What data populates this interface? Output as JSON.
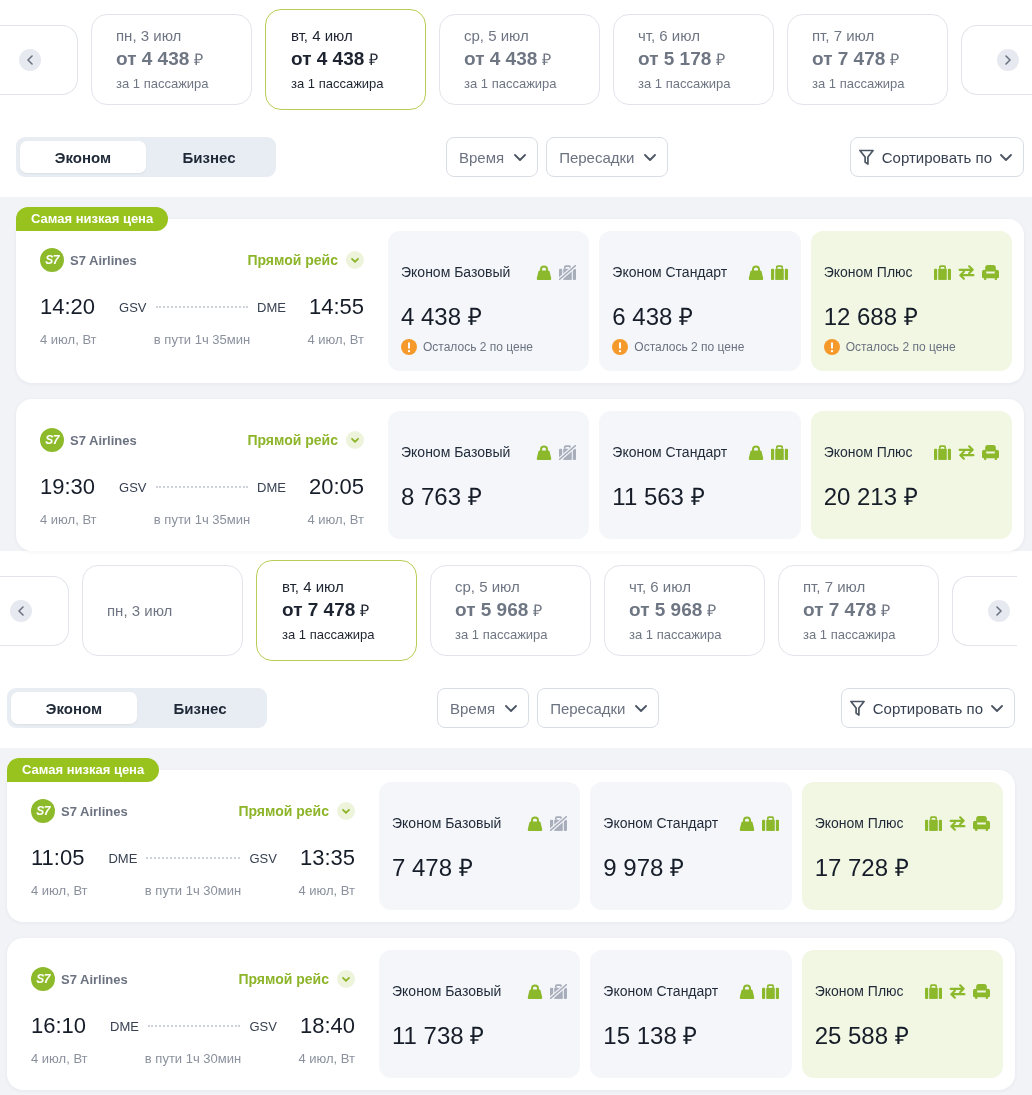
{
  "sections": [
    {
      "dates": [
        {
          "date": "пн, 3 июл",
          "price": "от 4 438",
          "currency": "₽",
          "note": "за 1 пассажира",
          "selected": false
        },
        {
          "date": "вт, 4 июл",
          "price": "от 4 438",
          "currency": "₽",
          "note": "за 1 пассажира",
          "selected": true
        },
        {
          "date": "ср, 5 июл",
          "price": "от 4 438",
          "currency": "₽",
          "note": "за 1 пассажира",
          "selected": false
        },
        {
          "date": "чт, 6 июл",
          "price": "от 5 178",
          "currency": "₽",
          "note": "за 1 пассажира",
          "selected": false
        },
        {
          "date": "пт, 7 июл",
          "price": "от 7 478",
          "currency": "₽",
          "note": "за 1 пассажира",
          "selected": false
        }
      ],
      "cabin_tabs": [
        {
          "label": "Эконом",
          "selected": true
        },
        {
          "label": "Бизнес",
          "selected": false
        }
      ],
      "filters": [
        {
          "kind": "dropdown",
          "label": "Время"
        },
        {
          "kind": "dropdown",
          "label": "Пересадки"
        },
        {
          "kind": "sort",
          "label": "Сортировать по"
        }
      ],
      "flights": [
        {
          "badge": "Самая низкая цена",
          "airline": {
            "logo": "S7",
            "name": "S7 Airlines"
          },
          "route_type": "Прямой рейс",
          "departure": {
            "time": "14:20",
            "airport": "GSV",
            "date": "4 июл, Вт"
          },
          "arrival": {
            "time": "14:55",
            "airport": "DME",
            "date": "4 июл, Вт"
          },
          "duration": "в пути 1ч 35мин",
          "fares": [
            {
              "name": "Эконом Базовый",
              "highlighted": false,
              "features": [
                {
                  "kind": "hand-luggage",
                  "included": true
                },
                {
                  "kind": "baggage",
                  "included": false
                }
              ],
              "price": "4 438 ₽",
              "note": "Осталось 2 по цене"
            },
            {
              "name": "Эконом Стандарт",
              "highlighted": false,
              "features": [
                {
                  "kind": "hand-luggage",
                  "included": true
                },
                {
                  "kind": "baggage",
                  "included": true
                }
              ],
              "price": "6 438 ₽",
              "note": "Осталось 2 по цене"
            },
            {
              "name": "Эконом Плюс",
              "highlighted": true,
              "features": [
                {
                  "kind": "baggage",
                  "included": true
                },
                {
                  "kind": "exchange",
                  "included": true
                },
                {
                  "kind": "seat",
                  "included": true
                }
              ],
              "price": "12 688 ₽",
              "note": "Осталось 2 по цене"
            }
          ]
        },
        {
          "airline": {
            "logo": "S7",
            "name": "S7 Airlines"
          },
          "route_type": "Прямой рейс",
          "departure": {
            "time": "19:30",
            "airport": "GSV",
            "date": "4 июл, Вт"
          },
          "arrival": {
            "time": "20:05",
            "airport": "DME",
            "date": "4 июл, Вт"
          },
          "duration": "в пути 1ч 35мин",
          "fares": [
            {
              "name": "Эконом Базовый",
              "highlighted": false,
              "features": [
                {
                  "kind": "hand-luggage",
                  "included": true
                },
                {
                  "kind": "baggage",
                  "included": false
                }
              ],
              "price": "8 763 ₽"
            },
            {
              "name": "Эконом Стандарт",
              "highlighted": false,
              "features": [
                {
                  "kind": "hand-luggage",
                  "included": true
                },
                {
                  "kind": "baggage",
                  "included": true
                }
              ],
              "price": "11 563 ₽"
            },
            {
              "name": "Эконом Плюс",
              "highlighted": true,
              "features": [
                {
                  "kind": "baggage",
                  "included": true
                },
                {
                  "kind": "exchange",
                  "included": true
                },
                {
                  "kind": "seat",
                  "included": true
                }
              ],
              "price": "20 213 ₽"
            }
          ]
        }
      ]
    },
    {
      "dates": [
        {
          "date": "пн, 3 июл",
          "selected": false
        },
        {
          "date": "вт, 4 июл",
          "price": "от 7 478",
          "currency": "₽",
          "note": "за 1 пассажира",
          "selected": true
        },
        {
          "date": "ср, 5 июл",
          "price": "от 5 968",
          "currency": "₽",
          "note": "за 1 пассажира",
          "selected": false
        },
        {
          "date": "чт, 6 июл",
          "price": "от 5 968",
          "currency": "₽",
          "note": "за 1 пассажира",
          "selected": false
        },
        {
          "date": "пт, 7 июл",
          "price": "от 7 478",
          "currency": "₽",
          "note": "за 1 пассажира",
          "selected": false
        }
      ],
      "cabin_tabs": [
        {
          "label": "Эконом",
          "selected": true
        },
        {
          "label": "Бизнес",
          "selected": false
        }
      ],
      "filters": [
        {
          "kind": "dropdown",
          "label": "Время"
        },
        {
          "kind": "dropdown",
          "label": "Пересадки"
        },
        {
          "kind": "sort",
          "label": "Сортировать по"
        }
      ],
      "flights": [
        {
          "badge": "Самая низкая цена",
          "airline": {
            "logo": "S7",
            "name": "S7 Airlines"
          },
          "route_type": "Прямой рейс",
          "departure": {
            "time": "11:05",
            "airport": "DME",
            "date": "4 июл, Вт"
          },
          "arrival": {
            "time": "13:35",
            "airport": "GSV",
            "date": "4 июл, Вт"
          },
          "duration": "в пути 1ч 30мин",
          "fares": [
            {
              "name": "Эконом Базовый",
              "highlighted": false,
              "features": [
                {
                  "kind": "hand-luggage",
                  "included": true
                },
                {
                  "kind": "baggage",
                  "included": false
                }
              ],
              "price": "7 478 ₽"
            },
            {
              "name": "Эконом Стандарт",
              "highlighted": false,
              "features": [
                {
                  "kind": "hand-luggage",
                  "included": true
                },
                {
                  "kind": "baggage",
                  "included": true
                }
              ],
              "price": "9 978 ₽"
            },
            {
              "name": "Эконом Плюс",
              "highlighted": true,
              "features": [
                {
                  "kind": "baggage",
                  "included": true
                },
                {
                  "kind": "exchange",
                  "included": true
                },
                {
                  "kind": "seat",
                  "included": true
                }
              ],
              "price": "17 728 ₽"
            }
          ]
        },
        {
          "airline": {
            "logo": "S7",
            "name": "S7 Airlines"
          },
          "route_type": "Прямой рейс",
          "departure": {
            "time": "16:10",
            "airport": "DME",
            "date": "4 июл, Вт"
          },
          "arrival": {
            "time": "18:40",
            "airport": "GSV",
            "date": "4 июл, Вт"
          },
          "duration": "в пути 1ч 30мин",
          "fares": [
            {
              "name": "Эконом Базовый",
              "highlighted": false,
              "features": [
                {
                  "kind": "hand-luggage",
                  "included": true
                },
                {
                  "kind": "baggage",
                  "included": false
                }
              ],
              "price": "11 738 ₽"
            },
            {
              "name": "Эконом Стандарт",
              "highlighted": false,
              "features": [
                {
                  "kind": "hand-luggage",
                  "included": true
                },
                {
                  "kind": "baggage",
                  "included": true
                }
              ],
              "price": "15 138 ₽"
            },
            {
              "name": "Эконом Плюс",
              "highlighted": true,
              "features": [
                {
                  "kind": "baggage",
                  "included": true
                },
                {
                  "kind": "exchange",
                  "included": true
                },
                {
                  "kind": "seat",
                  "included": true
                }
              ],
              "price": "25 588 ₽"
            }
          ]
        }
      ]
    }
  ]
}
